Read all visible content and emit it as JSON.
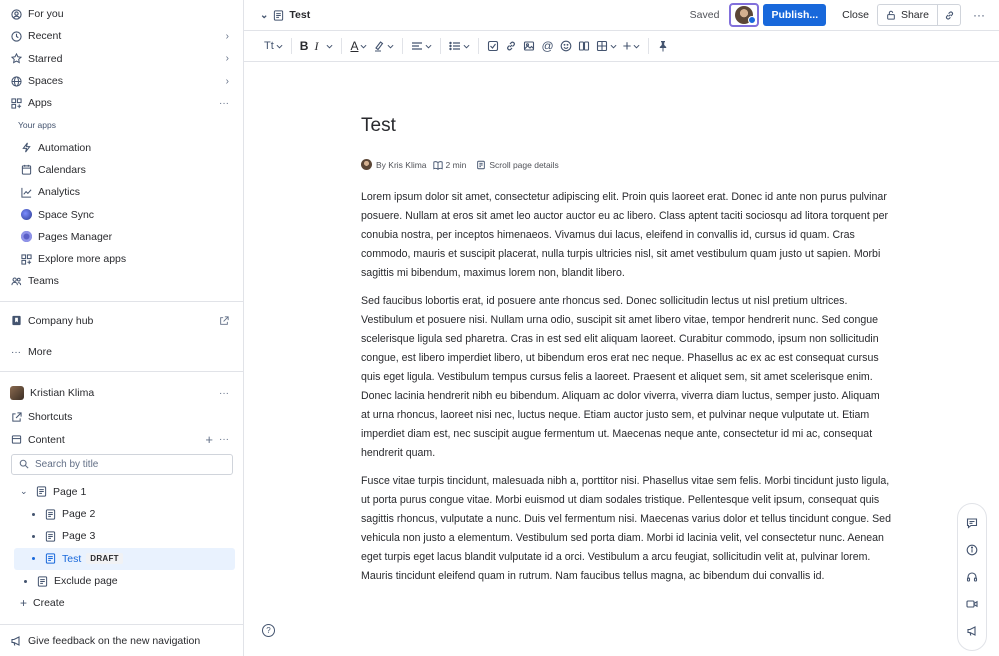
{
  "sidebar": {
    "top_items": [
      {
        "label": "For you",
        "icon": "user-circle-icon"
      },
      {
        "label": "Recent",
        "icon": "clock-icon"
      },
      {
        "label": "Starred",
        "icon": "star-icon"
      },
      {
        "label": "Spaces",
        "icon": "globe-icon"
      },
      {
        "label": "Apps",
        "icon": "apps-icon"
      }
    ],
    "your_apps_label": "Your apps",
    "apps": [
      {
        "label": "Automation",
        "icon": "lightning-icon"
      },
      {
        "label": "Calendars",
        "icon": "calendar-icon"
      },
      {
        "label": "Analytics",
        "icon": "chart-line-icon"
      },
      {
        "label": "Space Sync",
        "icon": "space-sync-icon"
      },
      {
        "label": "Pages Manager",
        "icon": "pages-manager-icon"
      },
      {
        "label": "Explore more apps",
        "icon": "grid-plus-icon"
      }
    ],
    "teams_label": "Teams",
    "company_hub_label": "Company hub",
    "more_label": "More",
    "space_name": "Kristian Klima",
    "shortcuts_label": "Shortcuts",
    "content_label": "Content",
    "search_placeholder": "Search by title",
    "tree": [
      {
        "label": "Page 1",
        "level": 0,
        "expanded": true
      },
      {
        "label": "Page 2",
        "level": 1
      },
      {
        "label": "Page 3",
        "level": 1
      },
      {
        "label": "Test",
        "level": 1,
        "selected": true,
        "badge": "DRAFT"
      },
      {
        "label": "Exclude page",
        "level": 0
      }
    ],
    "create_label": "Create",
    "feedback_label": "Give feedback on the new navigation"
  },
  "topbar": {
    "page_name": "Test",
    "saved_label": "Saved",
    "publish_label": "Publish...",
    "close_label": "Close",
    "share_label": "Share"
  },
  "toolbar": {
    "text_style": "Tt",
    "items": [
      "bold-icon",
      "italic-icon",
      "text-color-icon",
      "highlight-icon",
      "align-icon",
      "list-icon",
      "checkbox-icon",
      "link-icon",
      "image-icon",
      "mention-icon",
      "emoji-icon",
      "layout-icon",
      "table-icon",
      "insert-plus-icon",
      "pin-icon"
    ]
  },
  "document": {
    "title": "Test",
    "author": "By Kris Klima",
    "read_time": "2 min",
    "scroll_details": "Scroll page details",
    "paragraphs": [
      "Lorem ipsum dolor sit amet, consectetur adipiscing elit. Proin quis laoreet erat. Donec id ante non purus pulvinar posuere. Nullam at eros sit amet leo auctor auctor eu ac libero. Class aptent taciti sociosqu ad litora torquent per conubia nostra, per inceptos himenaeos. Vivamus dui lacus, eleifend in convallis id, cursus id quam. Cras commodo, mauris et suscipit placerat, nulla turpis ultricies nisl, sit amet vestibulum quam justo ut sapien. Morbi sagittis mi bibendum, maximus lorem non, blandit libero.",
      "Sed faucibus lobortis erat, id posuere ante rhoncus sed. Donec sollicitudin lectus ut nisl pretium ultrices. Vestibulum et posuere nisi. Nullam urna odio, suscipit sit amet libero vitae, tempor hendrerit nunc. Sed congue scelerisque ligula sed pharetra. Cras in est sed elit aliquam laoreet. Curabitur commodo, ipsum non sollicitudin congue, est libero imperdiet libero, ut bibendum eros erat nec neque. Phasellus ac ex ac est consequat cursus quis eget ligula. Vestibulum tempus cursus felis a laoreet. Praesent et aliquet sem, sit amet scelerisque enim. Donec lacinia hendrerit nibh eu bibendum. Aliquam ac dolor viverra, viverra diam luctus, semper justo. Aliquam at urna rhoncus, laoreet nisi nec, luctus neque. Etiam auctor justo sem, et pulvinar neque vulputate ut. Etiam imperdiet diam est, nec suscipit augue fermentum ut. Maecenas neque ante, consectetur id mi ac, consequat hendrerit quam.",
      "Fusce vitae turpis tincidunt, malesuada nibh a, porttitor nisi. Phasellus vitae sem felis. Morbi tincidunt justo ligula, ut porta purus congue vitae. Morbi euismod ut diam sodales tristique. Pellentesque velit ipsum, consequat quis sagittis rhoncus, vulputate a nunc. Duis vel fermentum nisi. Maecenas varius dolor et tellus tincidunt congue. Sed vehicula non justo a elementum. Vestibulum sed porta diam. Morbi id lacinia velit, vel consectetur nunc. Aenean eget turpis eget lacus blandit vulputate id a orci. Vestibulum a arcu feugiat, sollicitudin velit at, pulvinar lorem. Mauris tincidunt eleifend quam in rutrum. Nam faucibus tellus magna, ac bibendum dui convallis id."
    ]
  },
  "help_label": "?",
  "colors": {
    "accent": "#1868DB",
    "collab_border": "#8270DB",
    "selected_bg": "#E9F2FE"
  }
}
